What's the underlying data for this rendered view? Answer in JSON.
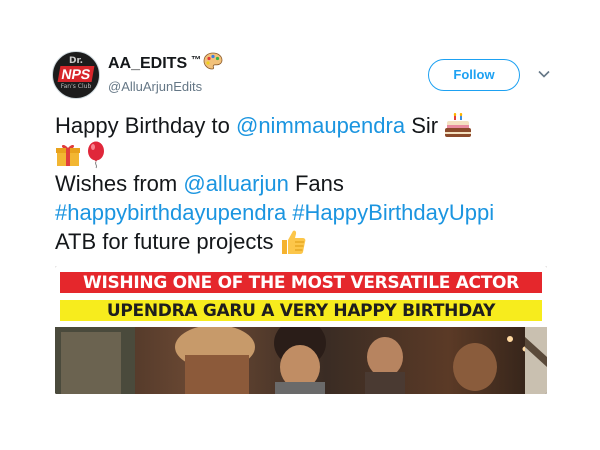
{
  "author": {
    "display_name": "AA_EDITS",
    "tm": "™",
    "handle": "@AlluArjunEdits",
    "avatar_text": {
      "top": "Dr.",
      "mid": "NPS",
      "bottom": "Fan's Club"
    }
  },
  "actions": {
    "follow_label": "Follow"
  },
  "tweet": {
    "line1": {
      "text": "Happy Birthday to ",
      "mention": "@nimmaupendra",
      "after": " Sir"
    },
    "line3": {
      "text": "Wishes from ",
      "mention": "@alluarjun",
      "after": " Fans"
    },
    "line4": {
      "hashtag1": "#happybirthdayupendra",
      "hashtag2": "#HappyBirthdayUppi"
    },
    "line5": {
      "text": "ATB for future projects"
    }
  },
  "media": {
    "banner_line1": "WISHING ONE OF THE MOST VERSATILE ACTOR",
    "banner_line2": "UPENDRA GARU A VERY HAPPY BIRTHDAY"
  },
  "icons": [
    "palette-icon",
    "caret-down-icon",
    "birthday-cake-icon",
    "gift-icon",
    "balloon-icon",
    "thumbs-up-icon"
  ],
  "colors": {
    "link": "#1b95e0",
    "follow": "#1da1f2",
    "banner_red": "#e5272c",
    "banner_yellow": "#f7ec1d"
  }
}
